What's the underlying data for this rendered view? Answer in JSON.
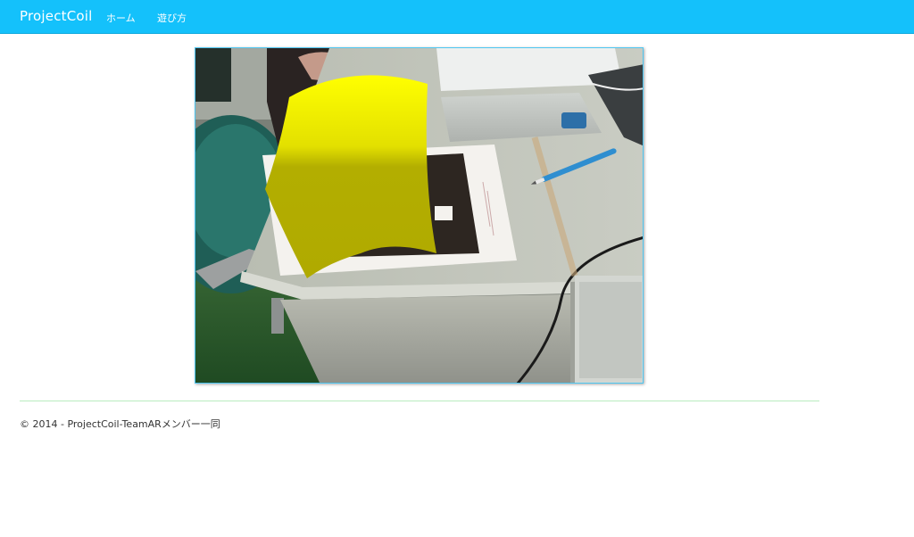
{
  "navbar": {
    "brand": "ProjectCoil",
    "links": [
      {
        "label": "ホーム"
      },
      {
        "label": "遊び方"
      }
    ],
    "color": "#14c1fb"
  },
  "main": {
    "viewer": {
      "scene": "camera-feed-with-ar-overlay",
      "overlay_color": "#ffff00",
      "frame_color": "#4ec7f2"
    }
  },
  "footer": {
    "text": "© 2014 - ProjectCoil-TeamARメンバー一同"
  }
}
